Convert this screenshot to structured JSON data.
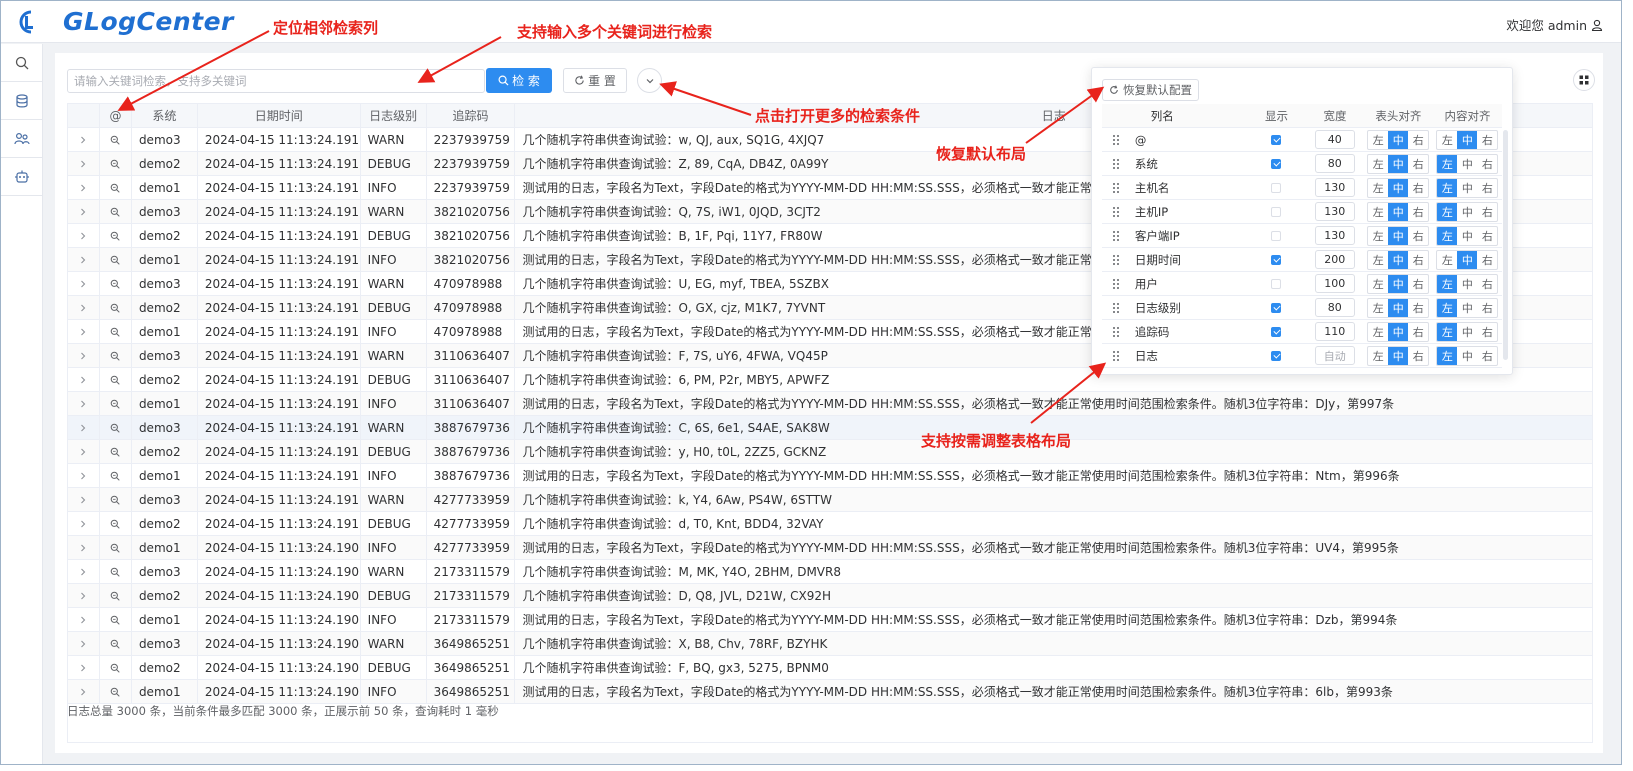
{
  "header": {
    "logo_text": "GLogCenter",
    "welcome": "欢迎您 admin"
  },
  "sidebar": {
    "items": [
      {
        "icon": "search-icon"
      },
      {
        "icon": "database-icon"
      },
      {
        "icon": "users-icon"
      },
      {
        "icon": "robot-icon"
      }
    ]
  },
  "search": {
    "placeholder": "请输入关键词检索，支持多关键词",
    "search_label": "检 索",
    "reset_label": "重 置"
  },
  "table": {
    "columns": [
      "@",
      "系统",
      "日期时间",
      "日志级别",
      "追踪码",
      "日志"
    ],
    "rows": [
      {
        "sys": "demo3",
        "dt": "2024-04-15 11:13:24.191",
        "lvl": "WARN",
        "trace": "2237939759",
        "log": "几个随机字符串供查询试验：w, QJ, aux, SQ1G, 4XJQ7"
      },
      {
        "sys": "demo2",
        "dt": "2024-04-15 11:13:24.191",
        "lvl": "DEBUG",
        "trace": "2237939759",
        "log": "几个随机字符串供查询试验：Z, 89, CqA, DB4Z, 0A99Y"
      },
      {
        "sys": "demo1",
        "dt": "2024-04-15 11:13:24.191",
        "lvl": "INFO",
        "trace": "2237939759",
        "log": "测试用的日志，字段名为Text，字段Date的格式为YYYY-MM-DD HH:MM:SS.SSS，必须格式一致才能正常使用时间范围检索条件。随机3位字符串："
      },
      {
        "sys": "demo3",
        "dt": "2024-04-15 11:13:24.191",
        "lvl": "WARN",
        "trace": "3821020756",
        "log": "几个随机字符串供查询试验：Q, 7S, iW1, 0JQD, 3CJT2"
      },
      {
        "sys": "demo2",
        "dt": "2024-04-15 11:13:24.191",
        "lvl": "DEBUG",
        "trace": "3821020756",
        "log": "几个随机字符串供查询试验：B, 1F, Pqi, 11Y7, FR80W"
      },
      {
        "sys": "demo1",
        "dt": "2024-04-15 11:13:24.191",
        "lvl": "INFO",
        "trace": "3821020756",
        "log": "测试用的日志，字段名为Text，字段Date的格式为YYYY-MM-DD HH:MM:SS.SSS，必须格式一致才能正常使用时间范围检索条件。随机3位字符串："
      },
      {
        "sys": "demo3",
        "dt": "2024-04-15 11:13:24.191",
        "lvl": "WARN",
        "trace": "470978988",
        "log": "几个随机字符串供查询试验：U, EG, myf, TBEA, 5SZBX"
      },
      {
        "sys": "demo2",
        "dt": "2024-04-15 11:13:24.191",
        "lvl": "DEBUG",
        "trace": "470978988",
        "log": "几个随机字符串供查询试验：O, GX, cjz, M1K7, 7YVNT"
      },
      {
        "sys": "demo1",
        "dt": "2024-04-15 11:13:24.191",
        "lvl": "INFO",
        "trace": "470978988",
        "log": "测试用的日志，字段名为Text，字段Date的格式为YYYY-MM-DD HH:MM:SS.SSS，必须格式一致才能正常使用时间范围检索条件。随机3位字符串："
      },
      {
        "sys": "demo3",
        "dt": "2024-04-15 11:13:24.191",
        "lvl": "WARN",
        "trace": "3110636407",
        "log": "几个随机字符串供查询试验：F, 7S, uY6, 4FWA, VQ45P"
      },
      {
        "sys": "demo2",
        "dt": "2024-04-15 11:13:24.191",
        "lvl": "DEBUG",
        "trace": "3110636407",
        "log": "几个随机字符串供查询试验：6, PM, P2r, MBY5, APWFZ"
      },
      {
        "sys": "demo1",
        "dt": "2024-04-15 11:13:24.191",
        "lvl": "INFO",
        "trace": "3110636407",
        "log": "测试用的日志，字段名为Text，字段Date的格式为YYYY-MM-DD HH:MM:SS.SSS，必须格式一致才能正常使用时间范围检索条件。随机3位字符串：DJy，第997条"
      },
      {
        "sys": "demo3",
        "dt": "2024-04-15 11:13:24.191",
        "lvl": "WARN",
        "trace": "3887679736",
        "log": "几个随机字符串供查询试验：C, 6S, 6e1, S4AE, SAK8W"
      },
      {
        "sys": "demo2",
        "dt": "2024-04-15 11:13:24.191",
        "lvl": "DEBUG",
        "trace": "3887679736",
        "log": "几个随机字符串供查询试验：y, H0, t0L, 2ZZ5, GCKNZ"
      },
      {
        "sys": "demo1",
        "dt": "2024-04-15 11:13:24.191",
        "lvl": "INFO",
        "trace": "3887679736",
        "log": "测试用的日志，字段名为Text，字段Date的格式为YYYY-MM-DD HH:MM:SS.SSS，必须格式一致才能正常使用时间范围检索条件。随机3位字符串：Ntm，第996条"
      },
      {
        "sys": "demo3",
        "dt": "2024-04-15 11:13:24.191",
        "lvl": "WARN",
        "trace": "4277733959",
        "log": "几个随机字符串供查询试验：k, Y4, 6Aw, PS4W, 6STTW"
      },
      {
        "sys": "demo2",
        "dt": "2024-04-15 11:13:24.191",
        "lvl": "DEBUG",
        "trace": "4277733959",
        "log": "几个随机字符串供查询试验：d, T0, Knt, BDD4, 32VAY"
      },
      {
        "sys": "demo1",
        "dt": "2024-04-15 11:13:24.190",
        "lvl": "INFO",
        "trace": "4277733959",
        "log": "测试用的日志，字段名为Text，字段Date的格式为YYYY-MM-DD HH:MM:SS.SSS，必须格式一致才能正常使用时间范围检索条件。随机3位字符串：UV4，第995条"
      },
      {
        "sys": "demo3",
        "dt": "2024-04-15 11:13:24.190",
        "lvl": "WARN",
        "trace": "2173311579",
        "log": "几个随机字符串供查询试验：M, MK, Y4O, 2BHM, DMVR8"
      },
      {
        "sys": "demo2",
        "dt": "2024-04-15 11:13:24.190",
        "lvl": "DEBUG",
        "trace": "2173311579",
        "log": "几个随机字符串供查询试验：D, Q8, JVL, D21W, CX92H"
      },
      {
        "sys": "demo1",
        "dt": "2024-04-15 11:13:24.190",
        "lvl": "INFO",
        "trace": "2173311579",
        "log": "测试用的日志，字段名为Text，字段Date的格式为YYYY-MM-DD HH:MM:SS.SSS，必须格式一致才能正常使用时间范围检索条件。随机3位字符串：Dzb，第994条"
      },
      {
        "sys": "demo3",
        "dt": "2024-04-15 11:13:24.190",
        "lvl": "WARN",
        "trace": "3649865251",
        "log": "几个随机字符串供查询试验：X, B8, Chv, 78RF, BZYHK"
      },
      {
        "sys": "demo2",
        "dt": "2024-04-15 11:13:24.190",
        "lvl": "DEBUG",
        "trace": "3649865251",
        "log": "几个随机字符串供查询试验：F, BQ, gx3, 5275, BPNM0"
      },
      {
        "sys": "demo1",
        "dt": "2024-04-15 11:13:24.190",
        "lvl": "INFO",
        "trace": "3649865251",
        "log": "测试用的日志，字段名为Text，字段Date的格式为YYYY-MM-DD HH:MM:SS.SSS，必须格式一致才能正常使用时间范围检索条件。随机3位字符串：6lb，第993条"
      }
    ],
    "highlight_row": 12
  },
  "footer": {
    "stats": "日志总量 3000 条，当前条件最多匹配 3000 条，正展示前 50 条，查询耗时 1 毫秒"
  },
  "column_settings": {
    "restore_label": "恢复默认配置",
    "headers": {
      "name": "列名",
      "show": "显示",
      "width": "宽度",
      "head_align": "表头对齐",
      "content_align": "内容对齐"
    },
    "align_labels": [
      "左",
      "中",
      "右"
    ],
    "rows": [
      {
        "name": "@",
        "show": true,
        "width": "40",
        "head_align": 1,
        "content_align": 1
      },
      {
        "name": "系统",
        "show": true,
        "width": "80",
        "head_align": 1,
        "content_align": 0
      },
      {
        "name": "主机名",
        "show": false,
        "width": "130",
        "head_align": 1,
        "content_align": 0
      },
      {
        "name": "主机IP",
        "show": false,
        "width": "130",
        "head_align": 1,
        "content_align": 0
      },
      {
        "name": "客户端IP",
        "show": false,
        "width": "130",
        "head_align": 1,
        "content_align": 0
      },
      {
        "name": "日期时间",
        "show": true,
        "width": "200",
        "head_align": 1,
        "content_align": 1
      },
      {
        "name": "用户",
        "show": false,
        "width": "100",
        "head_align": 1,
        "content_align": 0
      },
      {
        "name": "日志级别",
        "show": true,
        "width": "80",
        "head_align": 1,
        "content_align": 0
      },
      {
        "name": "追踪码",
        "show": true,
        "width": "110",
        "head_align": 1,
        "content_align": 0
      },
      {
        "name": "日志",
        "show": true,
        "width": "自动",
        "head_align": 1,
        "content_align": 0
      }
    ]
  },
  "annotations": {
    "locate_column": "定位相邻检索列",
    "multi_keyword": "支持输入多个关键词进行检索",
    "more_conditions": "点击打开更多的检索条件",
    "restore_layout": "恢复默认布局",
    "adjust_layout": "支持按需调整表格布局"
  },
  "colors": {
    "primary": "#2d8cf0",
    "annotation": "#e8231c",
    "logo": "#1f6fd1"
  }
}
